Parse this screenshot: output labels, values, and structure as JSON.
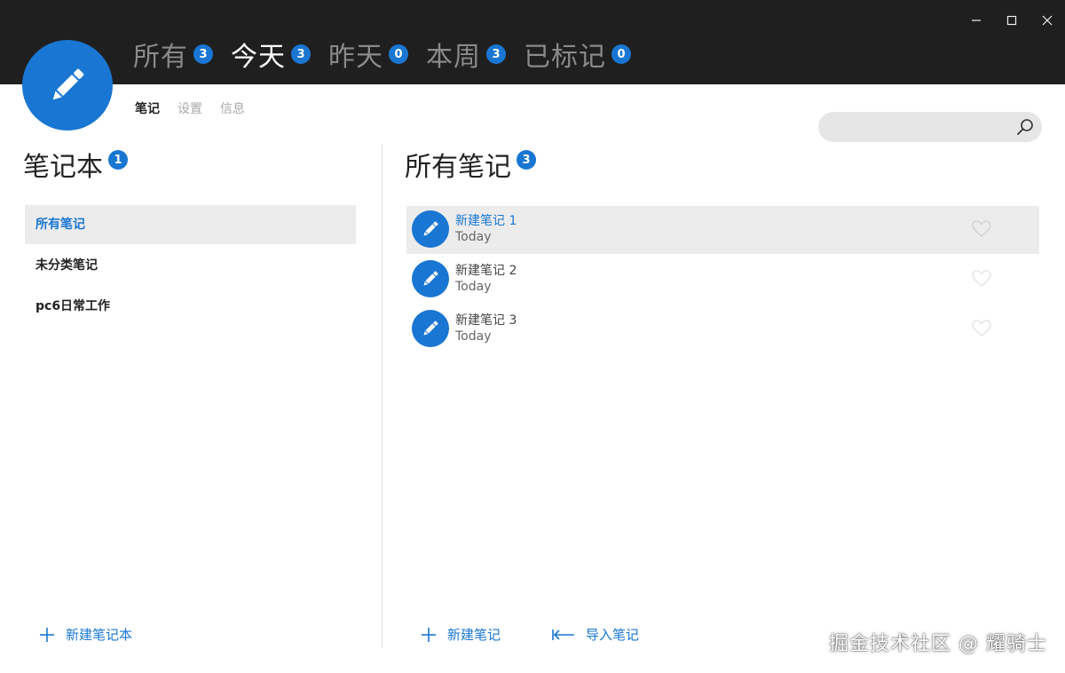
{
  "window": {
    "controls": [
      "minimize-icon",
      "maximize-icon",
      "close-icon"
    ]
  },
  "accent_color": "#1976d2",
  "filter_tabs": [
    {
      "label": "所有",
      "count": "3",
      "active": false
    },
    {
      "label": "今天",
      "count": "3",
      "active": true
    },
    {
      "label": "昨天",
      "count": "0",
      "active": false
    },
    {
      "label": "本周",
      "count": "3",
      "active": false
    },
    {
      "label": "已标记",
      "count": "0",
      "active": false
    }
  ],
  "sub_tabs": [
    {
      "label": "笔记",
      "active": true
    },
    {
      "label": "设置",
      "active": false
    },
    {
      "label": "信息",
      "active": false
    }
  ],
  "search": {
    "value": "",
    "placeholder": ""
  },
  "notebooks": {
    "title": "笔记本",
    "count": "1",
    "items": [
      {
        "label": "所有笔记",
        "active": true
      },
      {
        "label": "未分类笔记",
        "active": false
      },
      {
        "label": "pc6日常工作",
        "active": false
      }
    ],
    "new_label": "新建笔记本"
  },
  "notes": {
    "title": "所有笔记",
    "count": "3",
    "items": [
      {
        "title": "新建笔记 1",
        "date": "Today",
        "active": true
      },
      {
        "title": "新建笔记 2",
        "date": "Today",
        "active": false
      },
      {
        "title": "新建笔记 3",
        "date": "Today",
        "active": false
      }
    ],
    "new_label": "新建笔记",
    "import_label": "导入笔记"
  },
  "watermark": "掘金技术社区 @ 耀骑士"
}
